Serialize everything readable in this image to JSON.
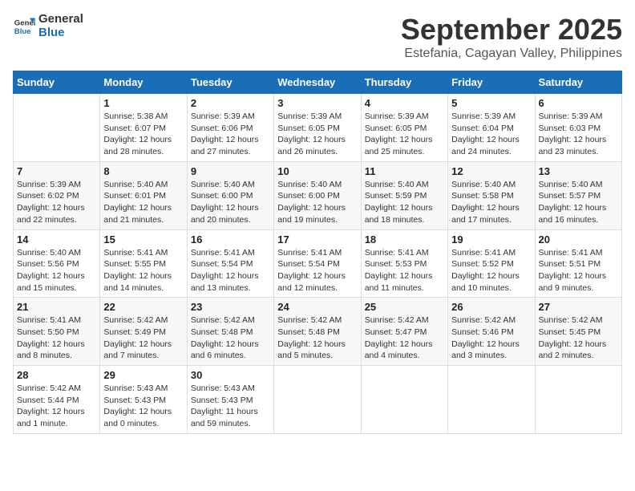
{
  "logo": {
    "line1": "General",
    "line2": "Blue"
  },
  "title": "September 2025",
  "subtitle": "Estefania, Cagayan Valley, Philippines",
  "header": {
    "accent_color": "#1a6eb5"
  },
  "weekdays": [
    "Sunday",
    "Monday",
    "Tuesday",
    "Wednesday",
    "Thursday",
    "Friday",
    "Saturday"
  ],
  "weeks": [
    [
      {
        "num": "",
        "info": ""
      },
      {
        "num": "1",
        "info": "Sunrise: 5:38 AM\nSunset: 6:07 PM\nDaylight: 12 hours\nand 28 minutes."
      },
      {
        "num": "2",
        "info": "Sunrise: 5:39 AM\nSunset: 6:06 PM\nDaylight: 12 hours\nand 27 minutes."
      },
      {
        "num": "3",
        "info": "Sunrise: 5:39 AM\nSunset: 6:05 PM\nDaylight: 12 hours\nand 26 minutes."
      },
      {
        "num": "4",
        "info": "Sunrise: 5:39 AM\nSunset: 6:05 PM\nDaylight: 12 hours\nand 25 minutes."
      },
      {
        "num": "5",
        "info": "Sunrise: 5:39 AM\nSunset: 6:04 PM\nDaylight: 12 hours\nand 24 minutes."
      },
      {
        "num": "6",
        "info": "Sunrise: 5:39 AM\nSunset: 6:03 PM\nDaylight: 12 hours\nand 23 minutes."
      }
    ],
    [
      {
        "num": "7",
        "info": "Sunrise: 5:39 AM\nSunset: 6:02 PM\nDaylight: 12 hours\nand 22 minutes."
      },
      {
        "num": "8",
        "info": "Sunrise: 5:40 AM\nSunset: 6:01 PM\nDaylight: 12 hours\nand 21 minutes."
      },
      {
        "num": "9",
        "info": "Sunrise: 5:40 AM\nSunset: 6:00 PM\nDaylight: 12 hours\nand 20 minutes."
      },
      {
        "num": "10",
        "info": "Sunrise: 5:40 AM\nSunset: 6:00 PM\nDaylight: 12 hours\nand 19 minutes."
      },
      {
        "num": "11",
        "info": "Sunrise: 5:40 AM\nSunset: 5:59 PM\nDaylight: 12 hours\nand 18 minutes."
      },
      {
        "num": "12",
        "info": "Sunrise: 5:40 AM\nSunset: 5:58 PM\nDaylight: 12 hours\nand 17 minutes."
      },
      {
        "num": "13",
        "info": "Sunrise: 5:40 AM\nSunset: 5:57 PM\nDaylight: 12 hours\nand 16 minutes."
      }
    ],
    [
      {
        "num": "14",
        "info": "Sunrise: 5:40 AM\nSunset: 5:56 PM\nDaylight: 12 hours\nand 15 minutes."
      },
      {
        "num": "15",
        "info": "Sunrise: 5:41 AM\nSunset: 5:55 PM\nDaylight: 12 hours\nand 14 minutes."
      },
      {
        "num": "16",
        "info": "Sunrise: 5:41 AM\nSunset: 5:54 PM\nDaylight: 12 hours\nand 13 minutes."
      },
      {
        "num": "17",
        "info": "Sunrise: 5:41 AM\nSunset: 5:54 PM\nDaylight: 12 hours\nand 12 minutes."
      },
      {
        "num": "18",
        "info": "Sunrise: 5:41 AM\nSunset: 5:53 PM\nDaylight: 12 hours\nand 11 minutes."
      },
      {
        "num": "19",
        "info": "Sunrise: 5:41 AM\nSunset: 5:52 PM\nDaylight: 12 hours\nand 10 minutes."
      },
      {
        "num": "20",
        "info": "Sunrise: 5:41 AM\nSunset: 5:51 PM\nDaylight: 12 hours\nand 9 minutes."
      }
    ],
    [
      {
        "num": "21",
        "info": "Sunrise: 5:41 AM\nSunset: 5:50 PM\nDaylight: 12 hours\nand 8 minutes."
      },
      {
        "num": "22",
        "info": "Sunrise: 5:42 AM\nSunset: 5:49 PM\nDaylight: 12 hours\nand 7 minutes."
      },
      {
        "num": "23",
        "info": "Sunrise: 5:42 AM\nSunset: 5:48 PM\nDaylight: 12 hours\nand 6 minutes."
      },
      {
        "num": "24",
        "info": "Sunrise: 5:42 AM\nSunset: 5:48 PM\nDaylight: 12 hours\nand 5 minutes."
      },
      {
        "num": "25",
        "info": "Sunrise: 5:42 AM\nSunset: 5:47 PM\nDaylight: 12 hours\nand 4 minutes."
      },
      {
        "num": "26",
        "info": "Sunrise: 5:42 AM\nSunset: 5:46 PM\nDaylight: 12 hours\nand 3 minutes."
      },
      {
        "num": "27",
        "info": "Sunrise: 5:42 AM\nSunset: 5:45 PM\nDaylight: 12 hours\nand 2 minutes."
      }
    ],
    [
      {
        "num": "28",
        "info": "Sunrise: 5:42 AM\nSunset: 5:44 PM\nDaylight: 12 hours\nand 1 minute."
      },
      {
        "num": "29",
        "info": "Sunrise: 5:43 AM\nSunset: 5:43 PM\nDaylight: 12 hours\nand 0 minutes."
      },
      {
        "num": "30",
        "info": "Sunrise: 5:43 AM\nSunset: 5:43 PM\nDaylight: 11 hours\nand 59 minutes."
      },
      {
        "num": "",
        "info": ""
      },
      {
        "num": "",
        "info": ""
      },
      {
        "num": "",
        "info": ""
      },
      {
        "num": "",
        "info": ""
      }
    ]
  ]
}
